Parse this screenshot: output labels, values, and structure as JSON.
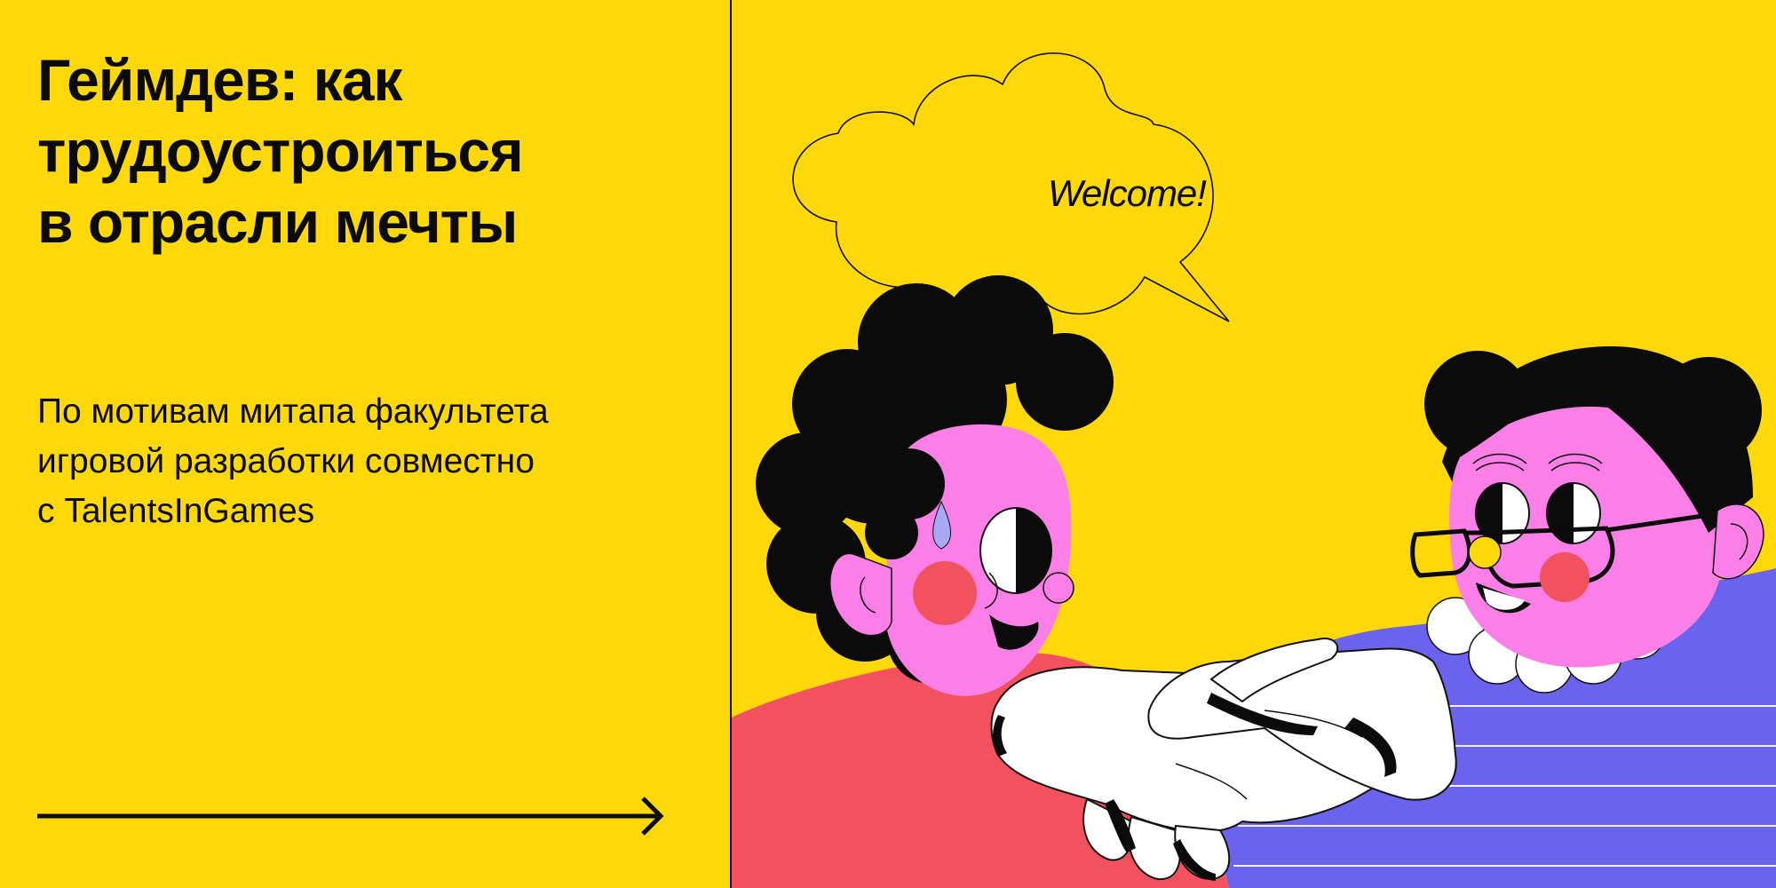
{
  "headline": {
    "lines": [
      "Геймдев: как",
      "трудоустроиться",
      "в отрасли мечты"
    ]
  },
  "subheadline": {
    "lines": [
      "По мотивам митапа факультета",
      "игровой разработки совместно",
      "с TalentsInGames"
    ]
  },
  "speech_bubble": {
    "text": "Welcome!"
  },
  "colors": {
    "background": "#fed809",
    "ink": "#0b0b0b",
    "skin": "#fb7fe7",
    "cheek": "#f2525f",
    "shirt_left": "#f2525f",
    "shirt_right": "#6b62ee",
    "tear": "#a9a8f2",
    "collar": "#ffffff"
  },
  "icons": [
    "arrow-right-icon",
    "speech-bubble-icon",
    "handshake-icon"
  ]
}
